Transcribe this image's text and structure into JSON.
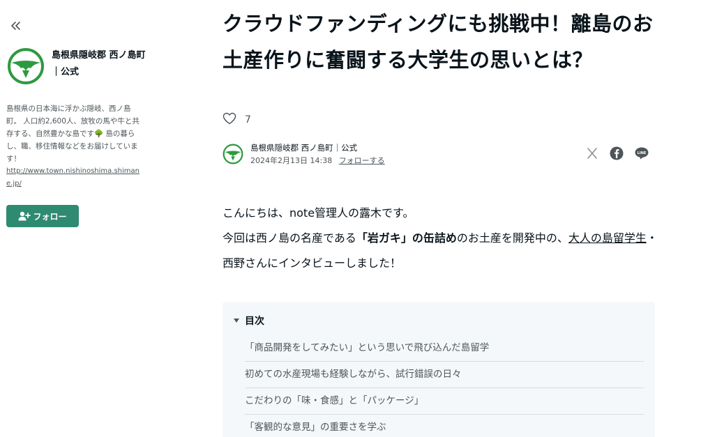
{
  "sidebar": {
    "creator_name": "島根県隠岐郡 西ノ島町｜公式",
    "bio": "島根県の日本海に浮かぶ隠岐、西ノ島町。 人口約2,600人、放牧の馬や牛と共存する、自然豊かな島です🌳 島の暮らし、職、移住情報などをお届けしています！",
    "link": "http://www.town.nishinoshima.shimane.jp/",
    "follow_label": "フォロー",
    "brand_color": "#2f8a72"
  },
  "article": {
    "title": "クラウドファンディングにも挑戦中！離島のお土産作りに奮闘する大学生の思いとは？",
    "like_count": "7",
    "byline": {
      "author": "島根県隠岐郡 西ノ島町｜公式",
      "date": "2024年2月13日 14:38",
      "follow_link": "フォローする"
    },
    "share_icons": [
      "x-icon",
      "facebook-icon",
      "line-icon"
    ],
    "body": {
      "line1": "こんにちは、note管理人の露木です。",
      "p2_a": "今回は西ノ島の名産である",
      "p2_bold": "「岩ガキ」の缶詰め",
      "p2_b": "のお土産を開発中の、",
      "p2_link": "大人の島留学生",
      "p2_c": "・西野さんにインタビューしました！"
    },
    "toc": {
      "heading": "目次",
      "items": [
        "「商品開発をしてみたい」という思いで飛び込んだ島留学",
        "初めての水産現場も経験しながら、試行錯誤の日々",
        "こだわりの「味・食感」と「パッケージ」",
        "「客観的な意見」の重要さを学ぶ"
      ]
    }
  }
}
